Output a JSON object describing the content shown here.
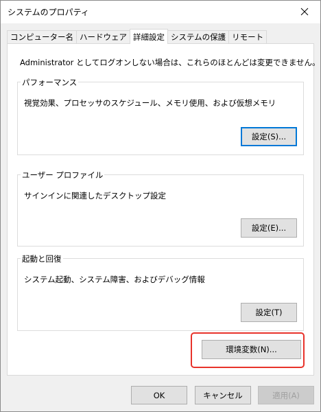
{
  "window": {
    "title": "システムのプロパティ",
    "close_icon": "close-icon"
  },
  "tabs": [
    {
      "label": "コンピューター名",
      "active": false
    },
    {
      "label": "ハードウェア",
      "active": false
    },
    {
      "label": "詳細設定",
      "active": true
    },
    {
      "label": "システムの保護",
      "active": false
    },
    {
      "label": "リモート",
      "active": false
    }
  ],
  "advanced": {
    "admin_note": "Administrator としてログオンしない場合は、これらのほとんどは変更できません。",
    "performance": {
      "title": "パフォーマンス",
      "description": "視覚効果、プロセッサのスケジュール、メモリ使用、および仮想メモリ",
      "button": "設定(S)..."
    },
    "user_profile": {
      "title": "ユーザー プロファイル",
      "description": "サインインに関連したデスクトップ設定",
      "button": "設定(E)..."
    },
    "startup_recovery": {
      "title": "起動と回復",
      "description": "システム起動、システム障害、およびデバッグ情報",
      "button": "設定(T)"
    },
    "env_button": "環境変数(N)..."
  },
  "footer": {
    "ok": "OK",
    "cancel": "キャンセル",
    "apply": "適用(A)"
  },
  "colors": {
    "highlight": "#e8322a",
    "default_button_border": "#0078d7"
  }
}
